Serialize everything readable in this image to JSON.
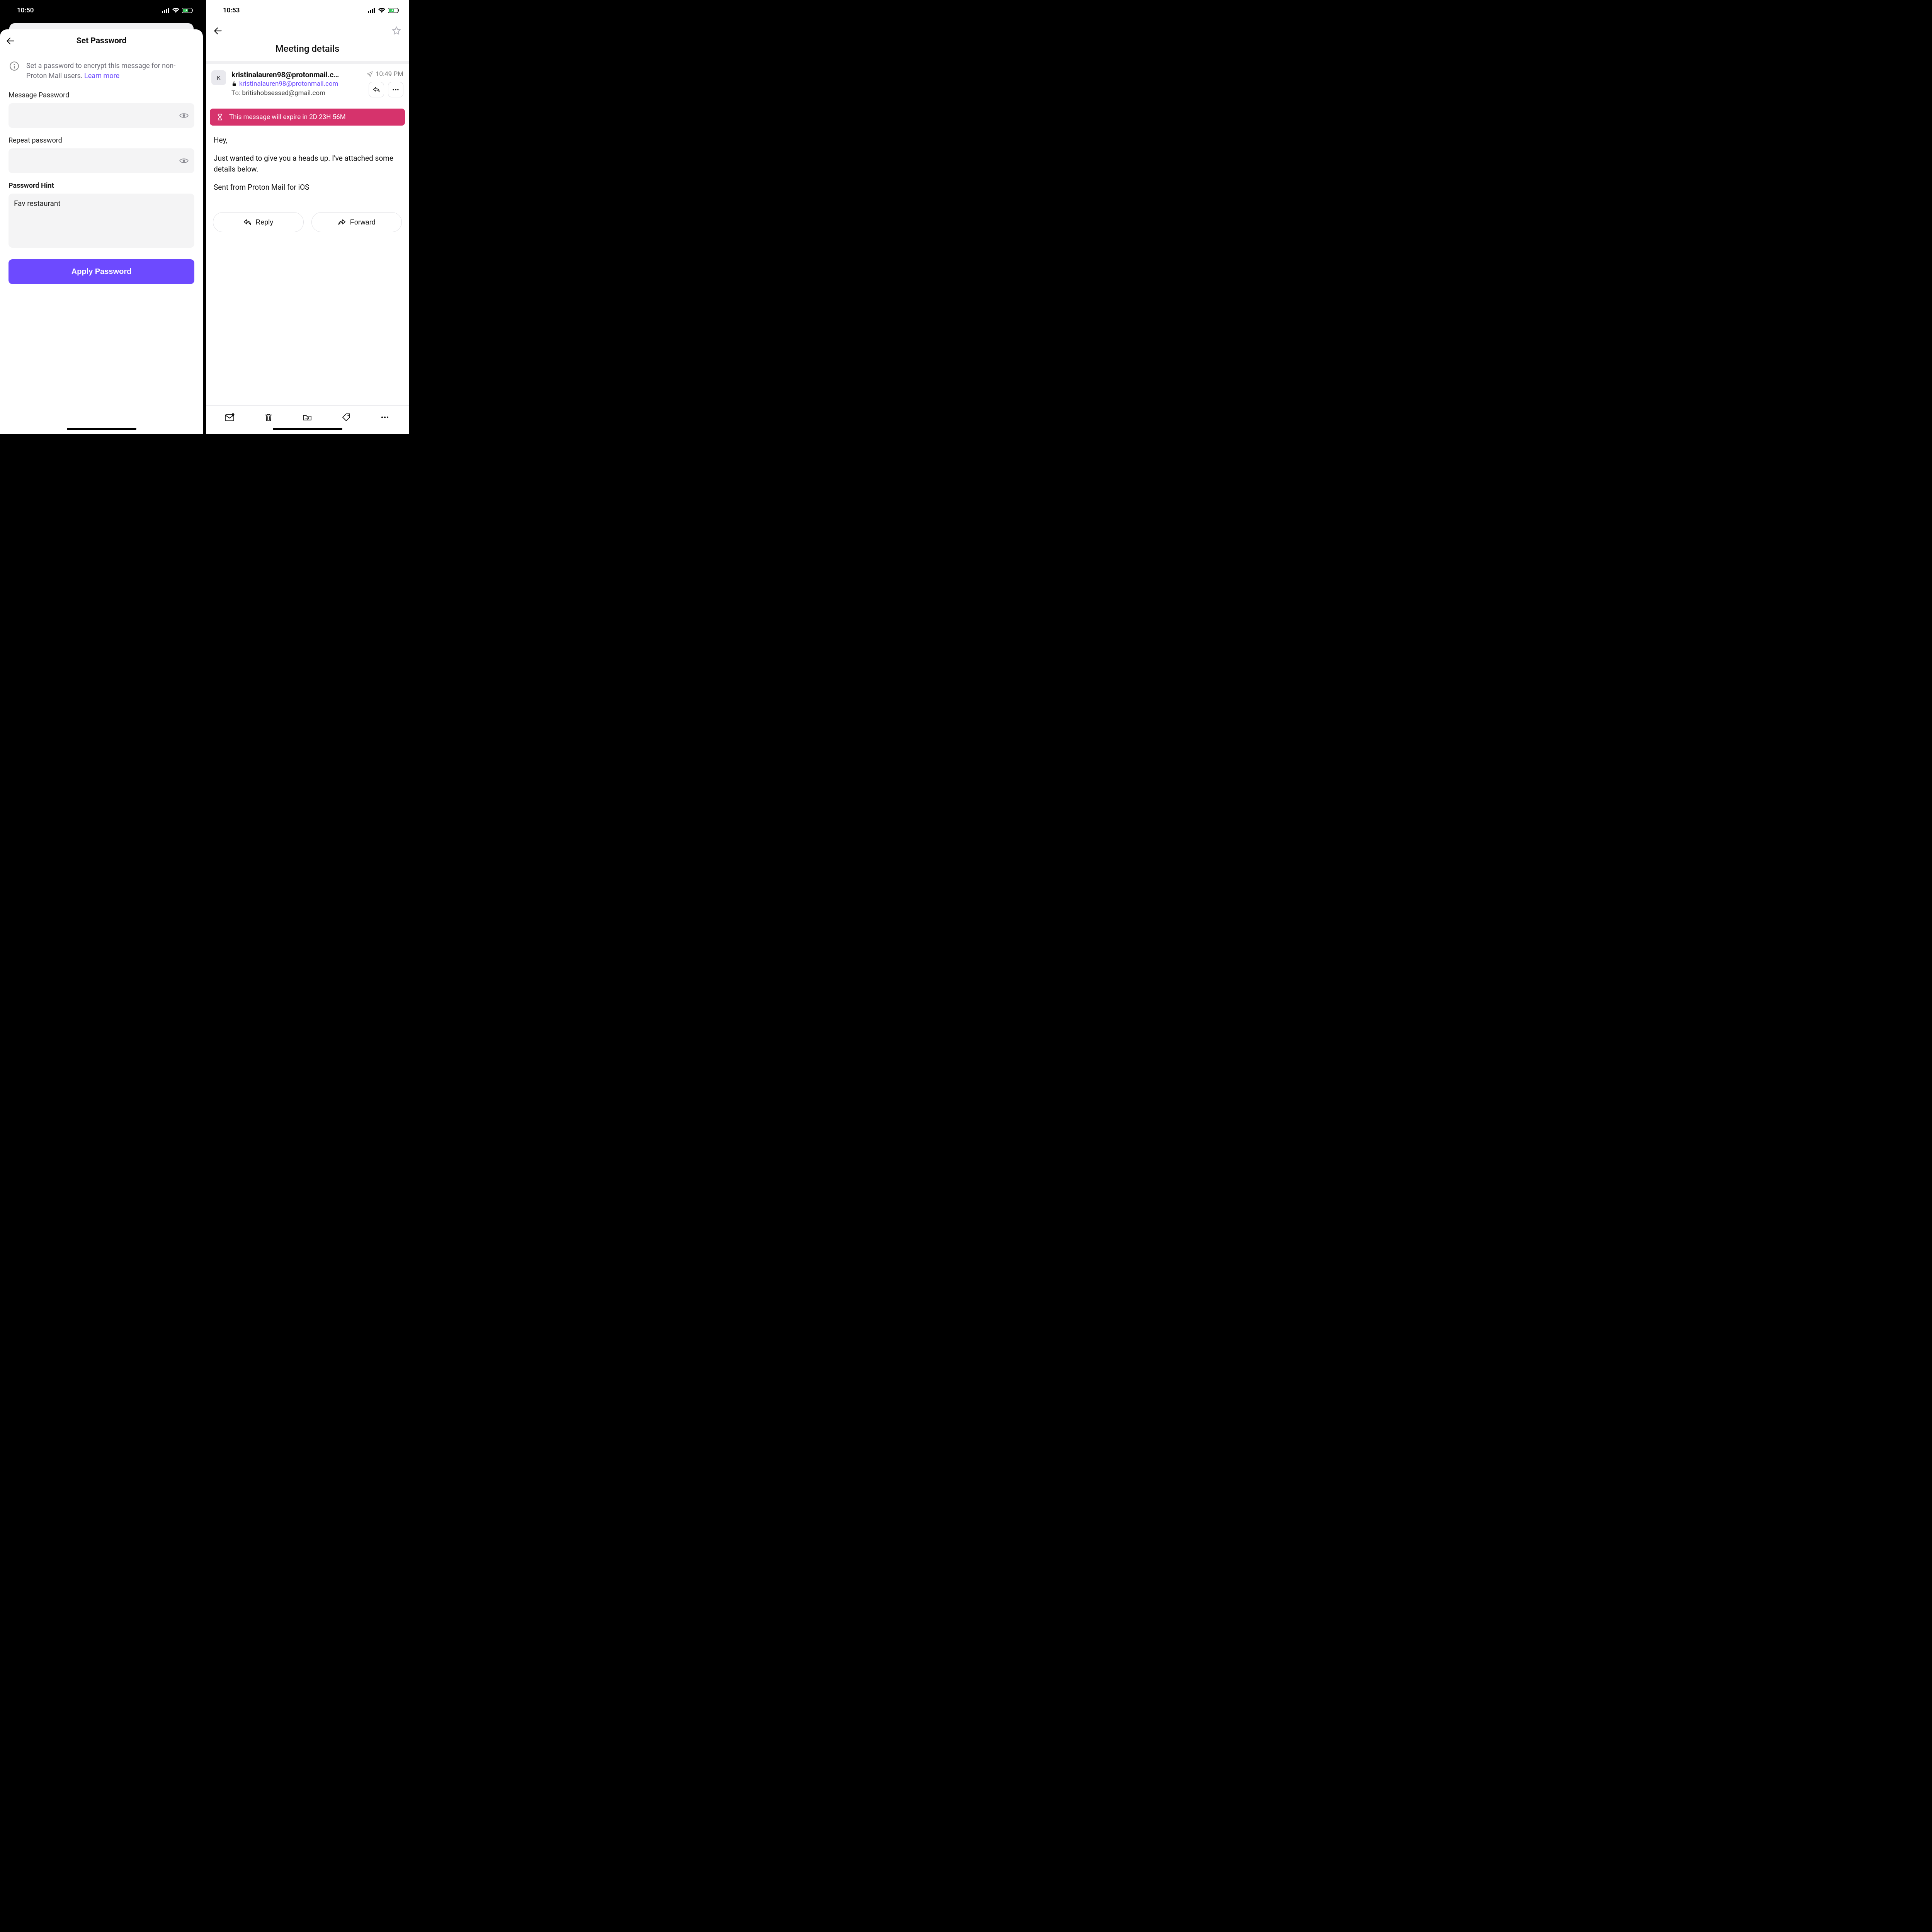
{
  "left": {
    "status": {
      "time": "10:50"
    },
    "title": "Set Password",
    "info_text": "Set a password to encrypt this message for non-Proton Mail users. ",
    "info_link": "Learn more",
    "labels": {
      "message_password": "Message Password",
      "repeat_password": "Repeat password",
      "password_hint": "Password Hint"
    },
    "fields": {
      "message_password_value": "",
      "repeat_password_value": "",
      "hint_value": "Fav restaurant"
    },
    "apply_button": "Apply Password"
  },
  "right": {
    "status": {
      "time": "10:53"
    },
    "subject": "Meeting details",
    "avatar_initial": "K",
    "from_display": "kristinalauren98@protonmail.c…",
    "from_full": "kristinalauren98@protonmail.com",
    "to_label": "To:",
    "to_address": "britishobsessed@gmail.com",
    "sent_time": "10:49 PM",
    "expire_text": "This message will expire in 2D 23H 56M",
    "body": {
      "p1": "Hey,",
      "p2": "Just wanted to give you a heads up. I've attached some details below.",
      "p3": "Sent from Proton Mail for iOS"
    },
    "buttons": {
      "reply": "Reply",
      "forward": "Forward"
    }
  }
}
